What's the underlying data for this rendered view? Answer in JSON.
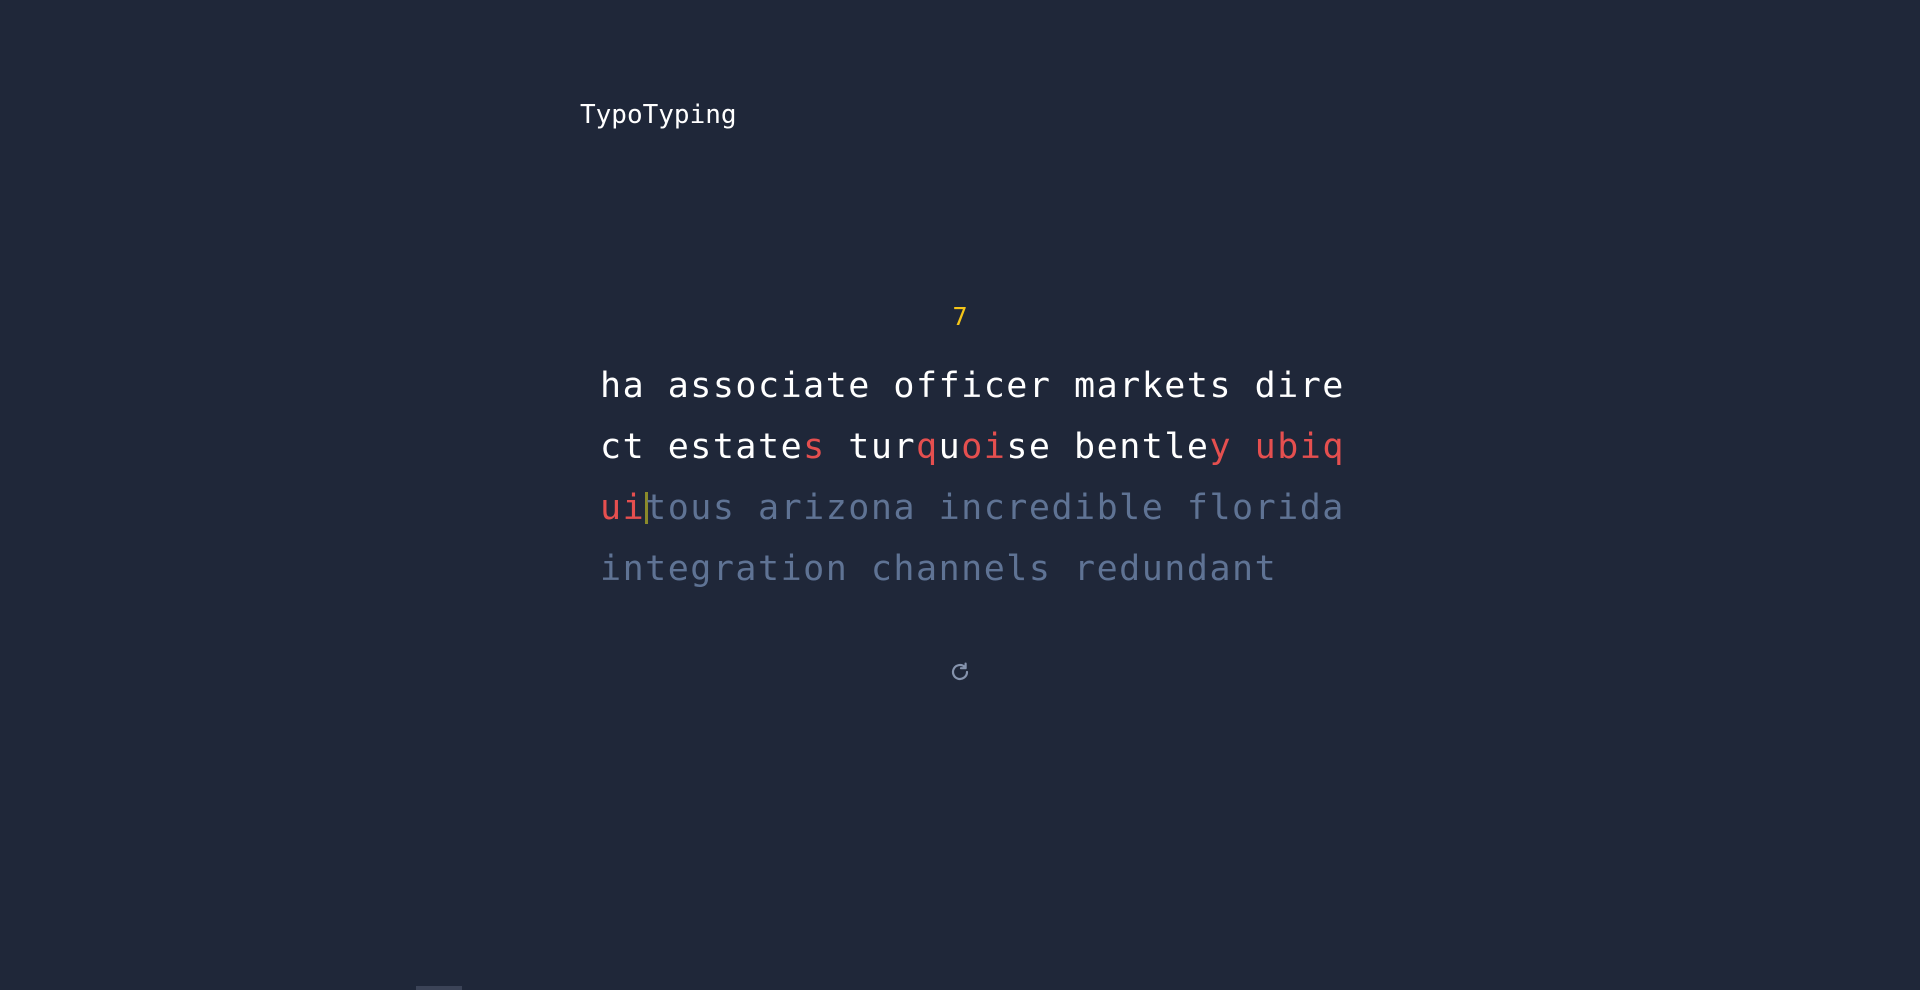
{
  "app": {
    "title": "TypoTyping"
  },
  "stats": {
    "counter": "7"
  },
  "colors": {
    "background": "#1f2739",
    "correct": "#ffffff",
    "wrong": "#e54f4f",
    "pending": "#5f7394",
    "counter": "#f5c518",
    "caret": "#8a8a2a"
  },
  "typing": {
    "lines": [
      [
        {
          "t": "ha associate officer markets dire",
          "s": "correct"
        }
      ],
      [
        {
          "t": "ct estate",
          "s": "correct"
        },
        {
          "t": "s",
          "s": "wrong"
        },
        {
          "t": " tur",
          "s": "correct"
        },
        {
          "t": "q",
          "s": "wrong"
        },
        {
          "t": "u",
          "s": "correct"
        },
        {
          "t": "oi",
          "s": "wrong"
        },
        {
          "t": "se bentle",
          "s": "correct"
        },
        {
          "t": "y ubiq",
          "s": "wrong"
        }
      ],
      [
        {
          "t": "ui",
          "s": "wrong"
        },
        {
          "t": "",
          "s": "caret"
        },
        {
          "t": "tous arizona incredible florida",
          "s": "pending"
        }
      ],
      [
        {
          "t": "integration channels redundant",
          "s": "pending"
        }
      ]
    ]
  },
  "controls": {
    "restart_icon": "refresh-icon"
  }
}
